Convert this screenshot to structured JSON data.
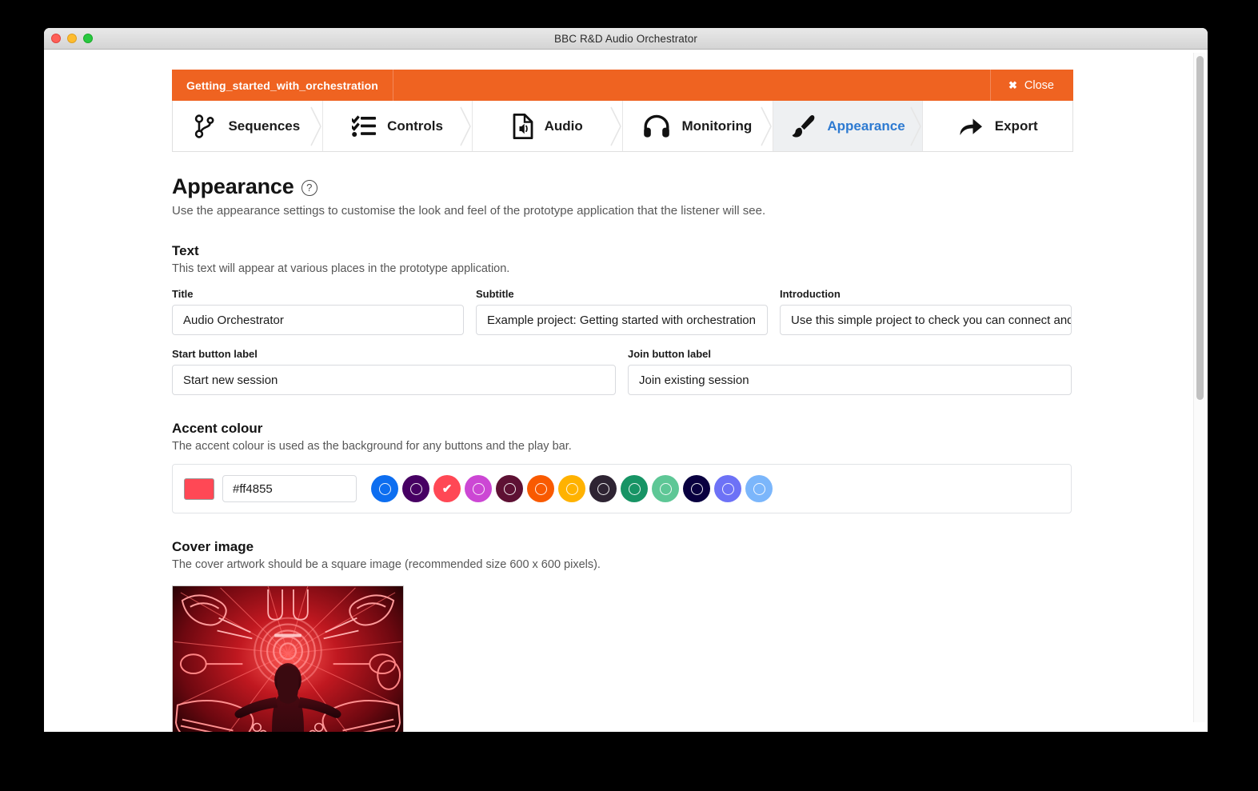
{
  "window": {
    "title": "BBC R&D Audio Orchestrator",
    "traffic_lights": [
      "close",
      "minimize",
      "zoom"
    ]
  },
  "header": {
    "project_name": "Getting_started_with_orchestration",
    "close_label": "Close",
    "close_icon": "close-x-icon",
    "bar_color": "#ef6321"
  },
  "tabs": [
    {
      "label": "Sequences",
      "icon": "branch-icon",
      "active": false
    },
    {
      "label": "Controls",
      "icon": "checklist-icon",
      "active": false
    },
    {
      "label": "Audio",
      "icon": "audio-file-icon",
      "active": false
    },
    {
      "label": "Monitoring",
      "icon": "headphones-icon",
      "active": false
    },
    {
      "label": "Appearance",
      "icon": "paintbrush-icon",
      "active": true
    },
    {
      "label": "Export",
      "icon": "share-arrow-icon",
      "active": false
    }
  ],
  "tab_active_color": "#2d7ad1",
  "page": {
    "title": "Appearance",
    "help_icon": "question-mark-icon",
    "description": "Use the appearance settings to customise the look and feel of the prototype application that the listener will see."
  },
  "text_section": {
    "title": "Text",
    "description": "This text will appear at various places in the prototype application.",
    "fields": [
      {
        "label": "Title",
        "value": "Audio Orchestrator"
      },
      {
        "label": "Subtitle",
        "value": "Example project: Getting started with orchestration"
      },
      {
        "label": "Introduction",
        "value": "Use this simple project to check you can connect and"
      },
      {
        "label": "Start button label",
        "value": "Start new session"
      },
      {
        "label": "Join button label",
        "value": "Join existing session"
      }
    ]
  },
  "accent_section": {
    "title": "Accent colour",
    "description": "The accent colour is used as the background for any buttons and the play bar.",
    "current_hex": "#ff4855",
    "swatches": [
      {
        "hex": "#0d6ef0",
        "selected": false
      },
      {
        "hex": "#470063",
        "selected": false
      },
      {
        "hex": "#ff4855",
        "selected": true
      },
      {
        "hex": "#cc47d4",
        "selected": false
      },
      {
        "hex": "#5e1134",
        "selected": false
      },
      {
        "hex": "#f95a00",
        "selected": false
      },
      {
        "hex": "#ffb200",
        "selected": false
      },
      {
        "hex": "#2e2433",
        "selected": false
      },
      {
        "hex": "#179465",
        "selected": false
      },
      {
        "hex": "#5ec796",
        "selected": false
      },
      {
        "hex": "#090040",
        "selected": false
      },
      {
        "hex": "#6d72f6",
        "selected": false
      },
      {
        "hex": "#7bb6fb",
        "selected": false
      }
    ]
  },
  "cover_section": {
    "title": "Cover image",
    "description": "The cover artwork should be a square image (recommended size 600 x 600 pixels).",
    "image_alt": "Red neon artwork of musical instruments radiating around a central figure"
  }
}
